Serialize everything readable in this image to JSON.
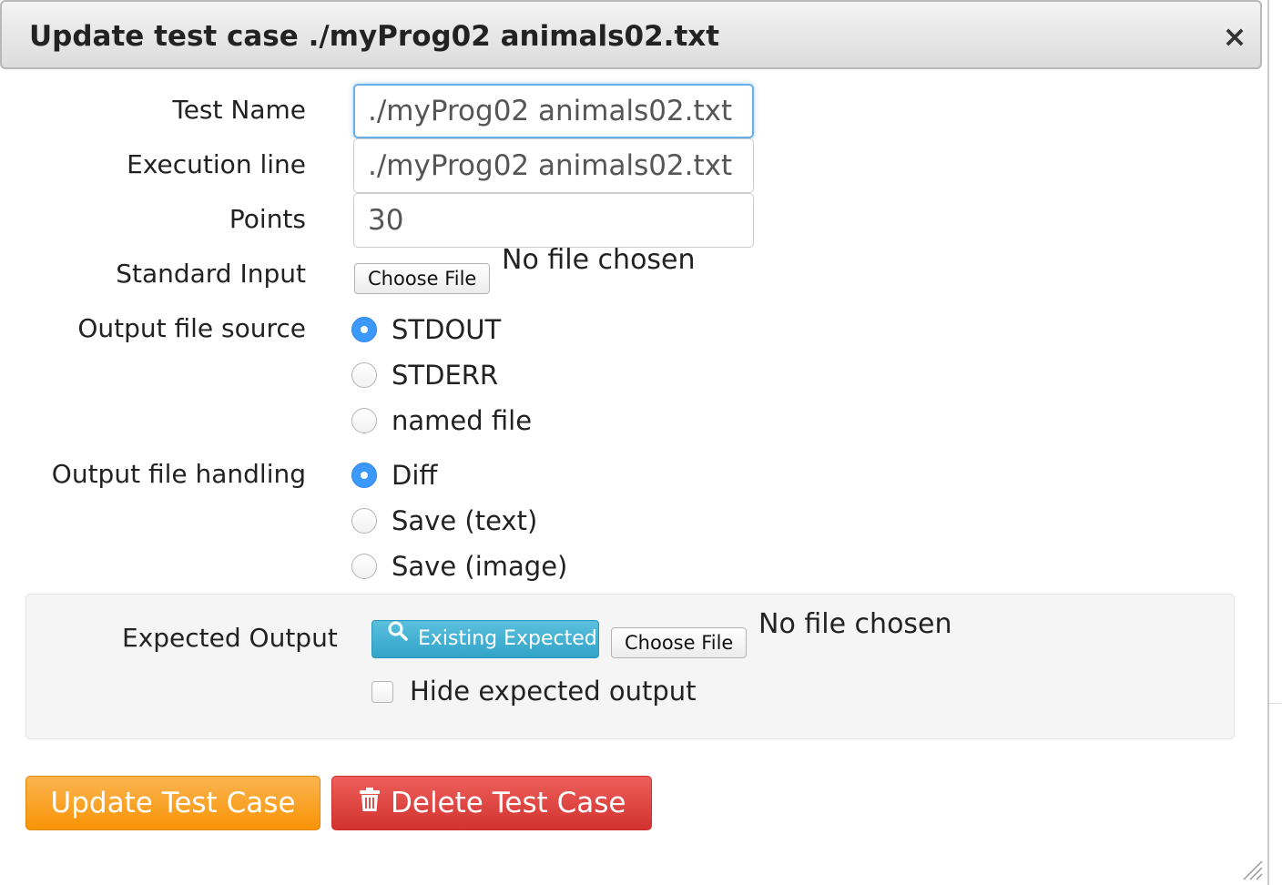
{
  "dialog": {
    "title": "Update test case ./myProg02 animals02.txt",
    "close_glyph": "×"
  },
  "form": {
    "test_name": {
      "label": "Test Name",
      "value": "./myProg02 animals02.txt"
    },
    "execution_line": {
      "label": "Execution line",
      "value": "./myProg02 animals02.txt"
    },
    "points": {
      "label": "Points",
      "value": "30"
    },
    "standard_input": {
      "label": "Standard Input",
      "button": "Choose File",
      "status": "No file chosen"
    },
    "output_file_source": {
      "label": "Output file source",
      "options": [
        "STDOUT",
        "STDERR",
        "named file"
      ],
      "selected": "STDOUT"
    },
    "output_file_handling": {
      "label": "Output file handling",
      "options": [
        "Diff",
        "Save (text)",
        "Save (image)"
      ],
      "selected": "Diff"
    },
    "expected_output": {
      "label": "Expected Output",
      "existing_button": "Existing Expected",
      "file_button": "Choose File",
      "status": "No file chosen",
      "hide_label": "Hide expected output",
      "hide_checked": false
    }
  },
  "actions": {
    "update": "Update Test Case",
    "delete": "Delete Test Case"
  },
  "icons": {
    "close": "close-icon",
    "search": "search-icon",
    "trash": "trash-icon",
    "resize": "resize-grip-icon"
  },
  "colors": {
    "focus_border": "#66afe9",
    "radio_checked": "#3b99fc",
    "info_button": "#5bc0de",
    "warning_button": "#f89406",
    "danger_button": "#d9534f"
  }
}
